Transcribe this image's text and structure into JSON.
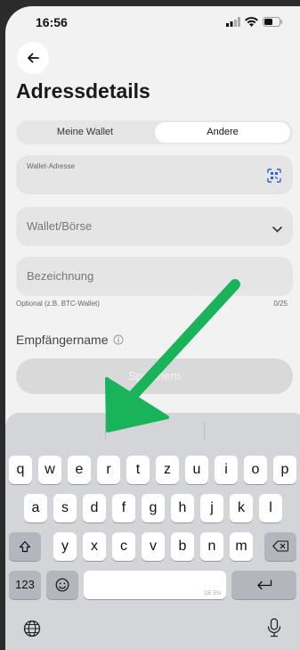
{
  "status_bar": {
    "time": "16:56"
  },
  "header": {
    "title": "Adressdetails"
  },
  "segmented": {
    "options": [
      "Meine Wallet",
      "Andere"
    ],
    "selected": "Andere"
  },
  "form": {
    "wallet_address_label": "Wallet-Adresse",
    "exchange_placeholder": "Wallet/Börse",
    "name_placeholder": "Bezeichnung",
    "name_hint": "Optional (z.B. BTC-Wallet)",
    "name_counter": "0/25",
    "recipient_label": "Empfängername",
    "save_label": "Speichern"
  },
  "keyboard": {
    "row1": [
      "q",
      "w",
      "e",
      "r",
      "t",
      "z",
      "u",
      "i",
      "o",
      "p"
    ],
    "row2": [
      "a",
      "s",
      "d",
      "f",
      "g",
      "h",
      "j",
      "k",
      "l"
    ],
    "row3": [
      "y",
      "x",
      "c",
      "v",
      "b",
      "n",
      "m"
    ],
    "numbers_label": "123",
    "space_languages": "DE EN"
  },
  "colors": {
    "arrow": "#19b35a",
    "background": "#f2f2f2",
    "field": "#e5e5e5"
  }
}
